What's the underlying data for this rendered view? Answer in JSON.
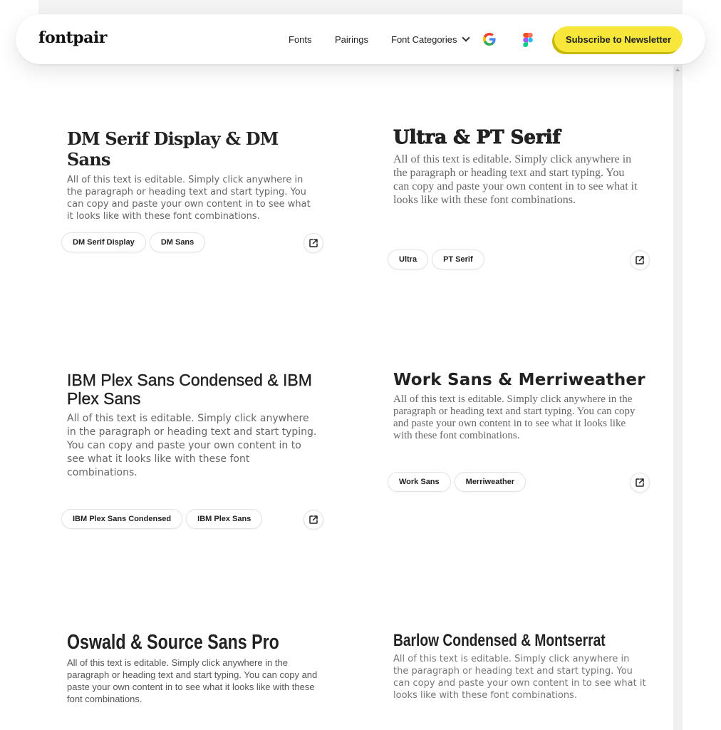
{
  "nav": {
    "logo": "fontpair",
    "links": [
      "Fonts",
      "Pairings",
      "Font Categories"
    ],
    "subscribe_label": "Subscribe to Newsletter",
    "icons": [
      "google-icon",
      "figma-icon",
      "chevron-down-icon"
    ]
  },
  "body_text": "All of this text is editable. Simply click anywhere in the paragraph or heading text and start typing. You can copy and paste your own content in to see what it looks like with these font combinations.",
  "cards": [
    {
      "title": "DM Serif Display & DM Sans",
      "tags": [
        "DM Serif Display",
        "DM Sans"
      ]
    },
    {
      "title": "Ultra & PT Serif",
      "tags": [
        "Ultra",
        "PT Serif"
      ]
    },
    {
      "title": "IBM Plex Sans Condensed & IBM Plex Sans",
      "tags": [
        "IBM Plex Sans Condensed",
        "IBM Plex Sans"
      ]
    },
    {
      "title": "Work Sans & Merriweather",
      "tags": [
        "Work Sans",
        "Merriweather"
      ]
    },
    {
      "title": "Oswald & Source Sans Pro",
      "tags": []
    },
    {
      "title": "Barlow Condensed & Montserrat",
      "tags": []
    }
  ],
  "colors": {
    "accent_yellow": "#f6e73a",
    "title_text": "#222222",
    "body_text": "#666666"
  }
}
